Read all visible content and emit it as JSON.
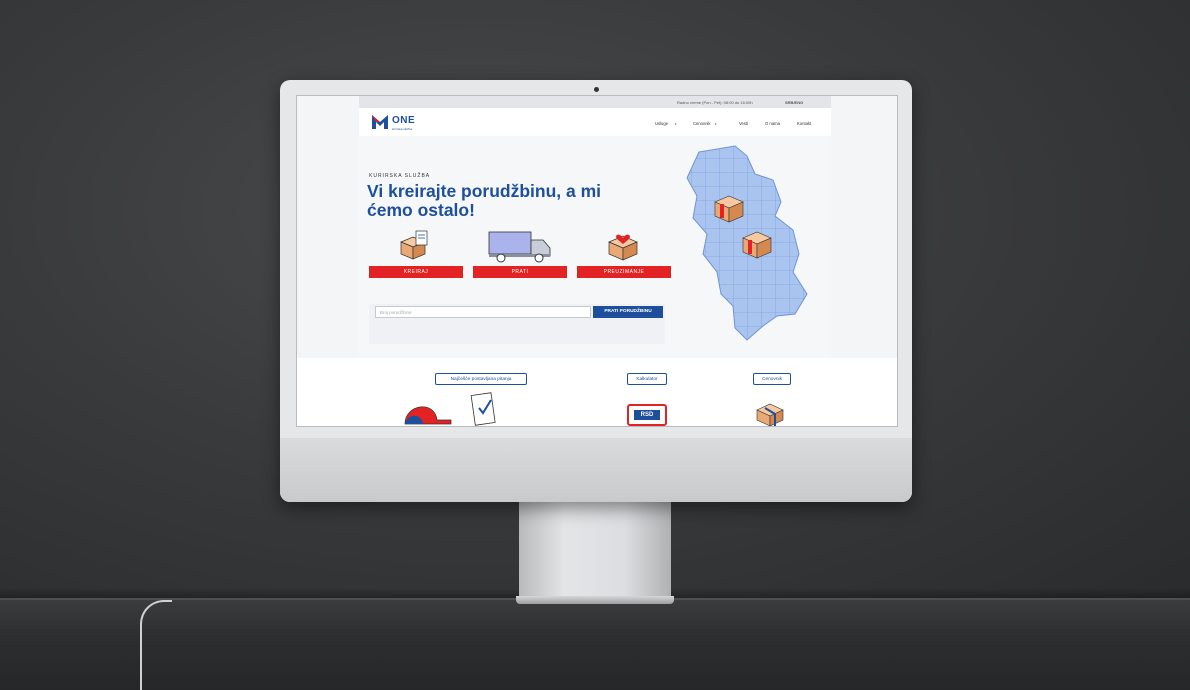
{
  "site": {
    "topbar": {
      "hours": "Radno vreme (Pon - Pet): 08:00 do 16:00h",
      "language": "SRB/ENG"
    },
    "logo": {
      "name": "ONE",
      "tagline": "kurirska služba"
    },
    "nav": [
      "Usluge",
      "Cenovnik",
      "Vesti",
      "O nama",
      "Kontakt"
    ],
    "hero": {
      "eyebrow": "KURIRSKA SLUŽBA",
      "headline": "Vi kreirajte porudžbinu, a mi ćemo ostalo!",
      "actions": [
        "KREIRAJ",
        "PRATI",
        "PREUZIMANJE"
      ],
      "tracking": {
        "placeholder": "Broj porudžbine",
        "button": "PRATI PORUDŽBINU"
      }
    },
    "features": [
      "Najčešće postavljana pitanja",
      "Kalkulator",
      "Cenovnik"
    ],
    "currency_badge": "RSD"
  },
  "colors": {
    "brand_blue": "#1d4f9c",
    "brand_red": "#e32323",
    "wall": "#3a3b3d"
  }
}
